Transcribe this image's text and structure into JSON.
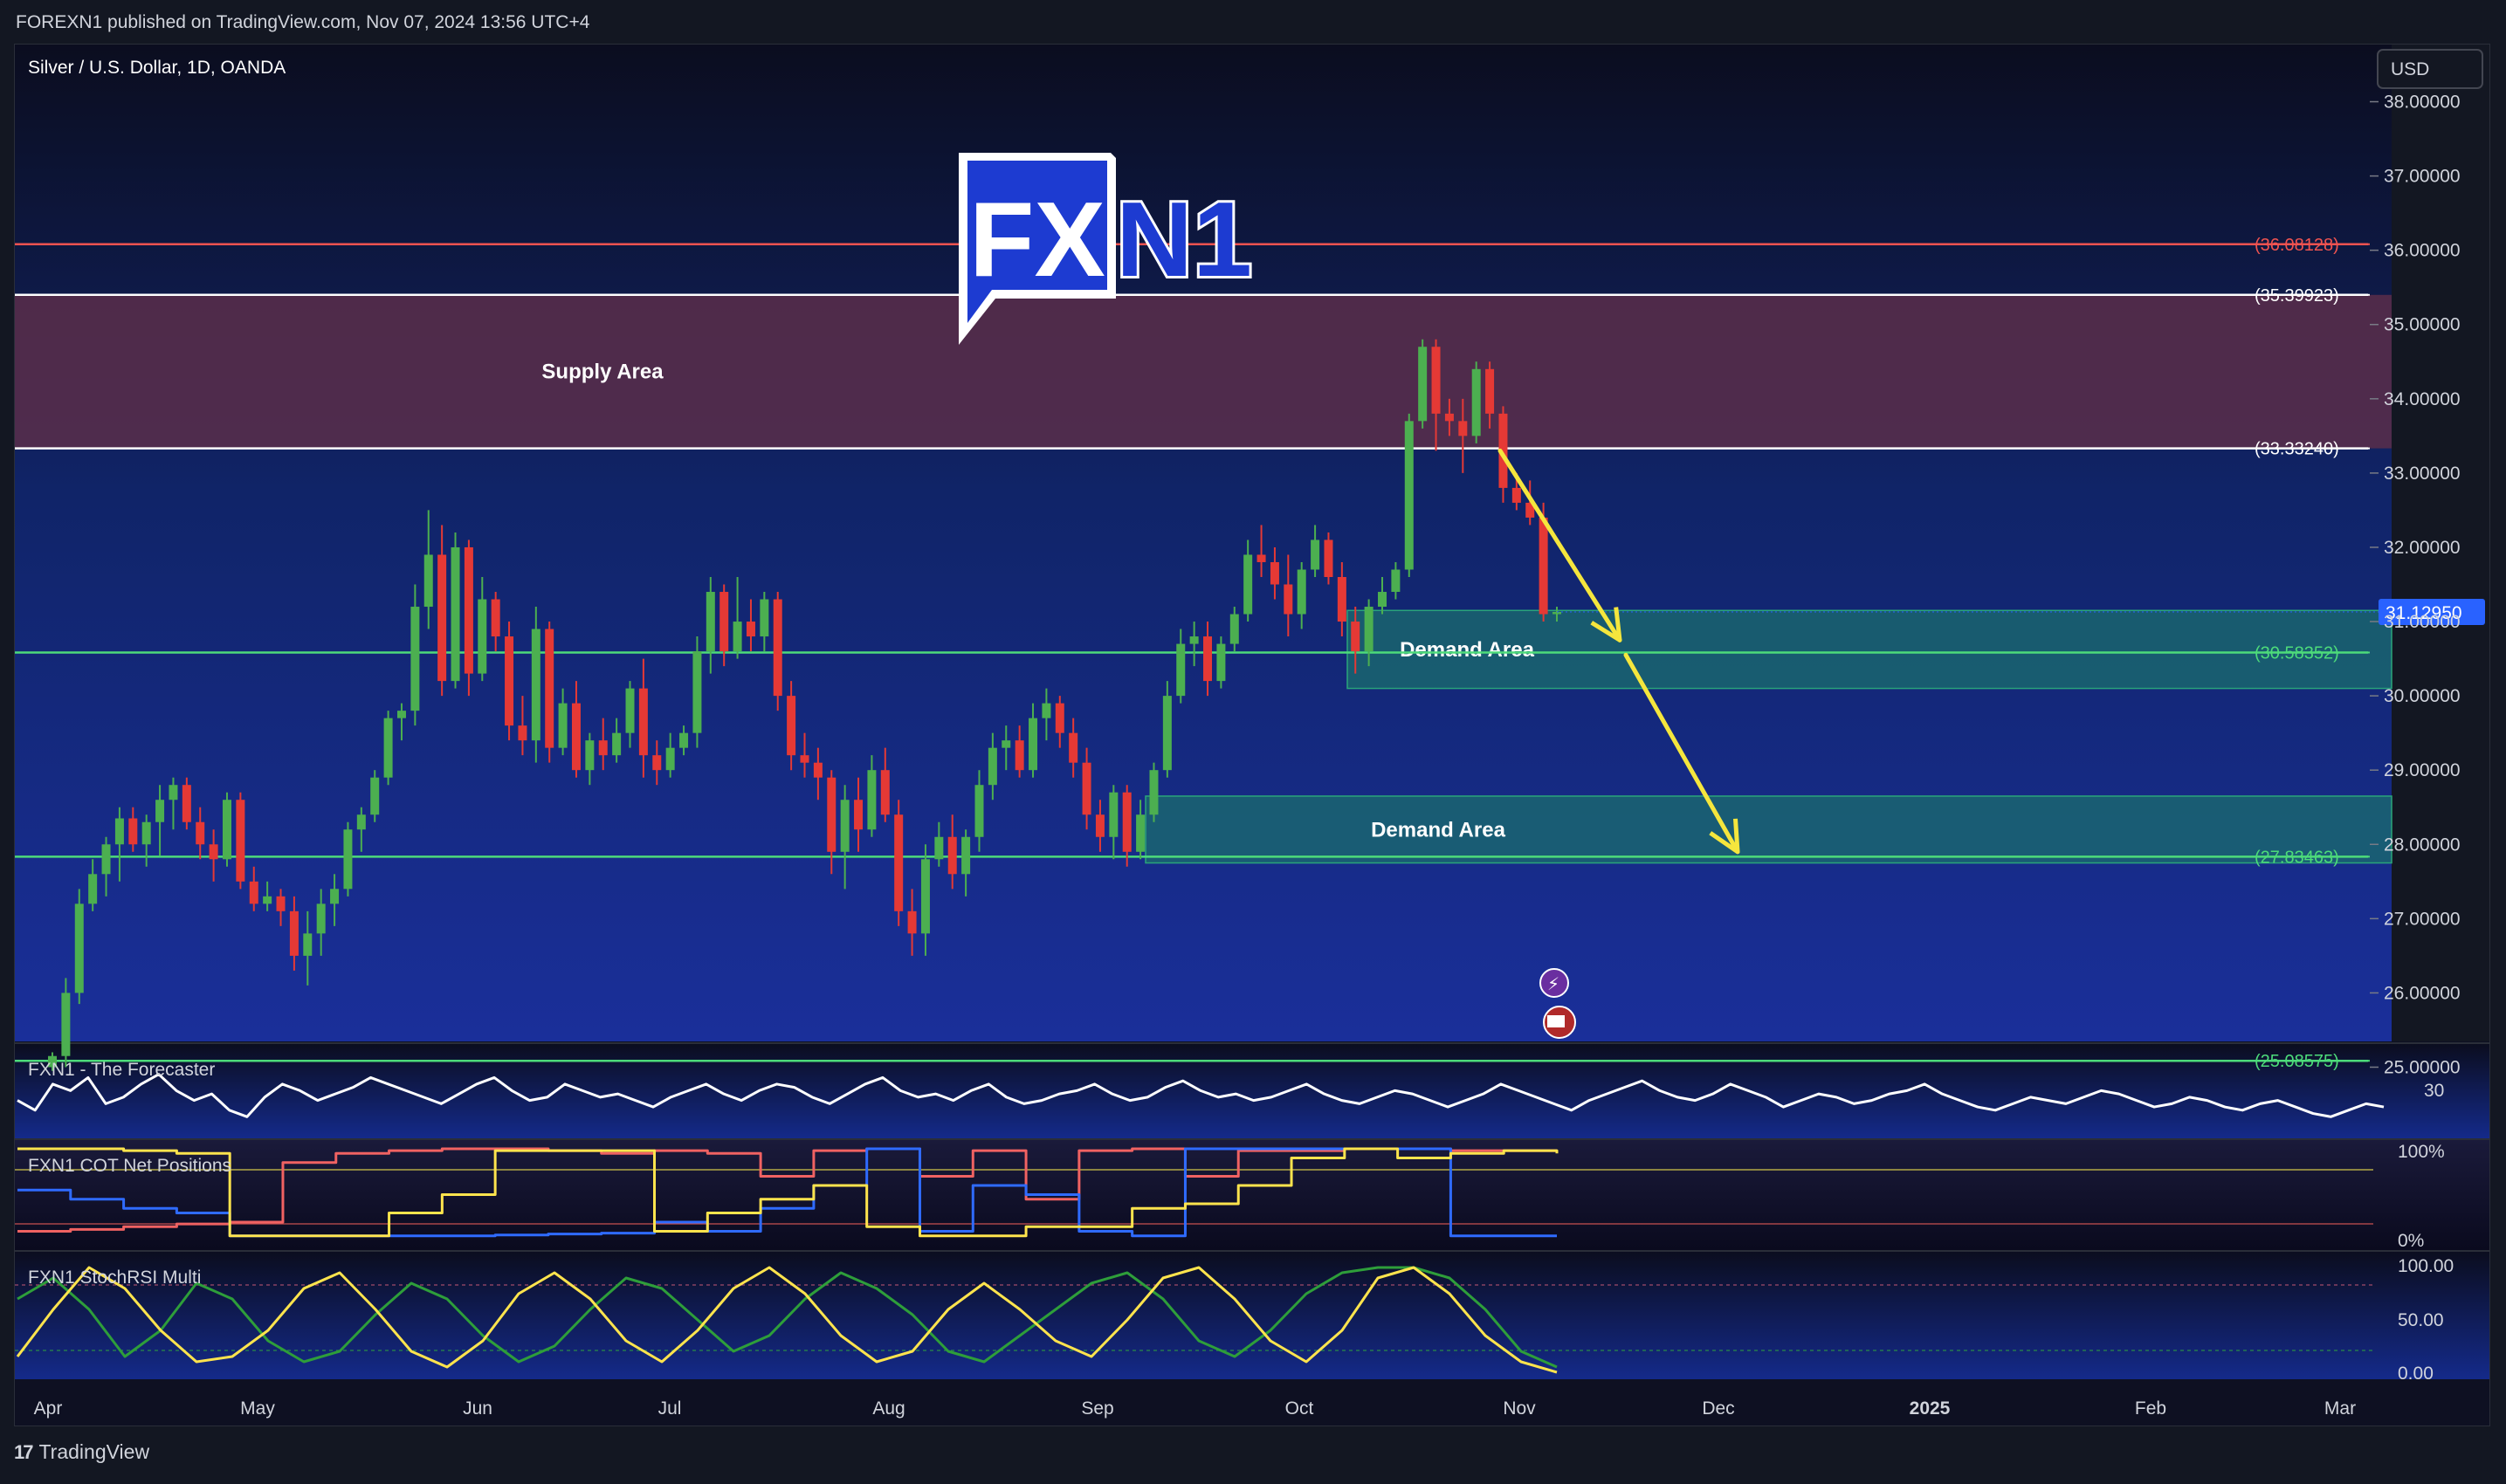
{
  "header": {
    "published_text": "FOREXN1 published on TradingView.com, Nov 07, 2024 13:56 UTC+4"
  },
  "chart": {
    "symbol_title": "Silver / U.S. Dollar, 1D, OANDA",
    "currency_button": "USD",
    "logo_text": {
      "fx": "FX",
      "n1": "N1"
    }
  },
  "footer": {
    "brand": "TradingView",
    "logo_glyph": "17"
  },
  "colors": {
    "background_top": "#0b0d1f",
    "background_bottom": "#1a2f9a",
    "bull": "#4caf50",
    "bear": "#e53935",
    "supply_zone": "#5a2e4a",
    "demand_zone": "#1b6e6e",
    "resistance_red": "#ef5350",
    "level_white": "#ffffff",
    "level_green": "#4ddb7a",
    "arrow_yellow": "#f5e63d",
    "forecaster_line": "#ffffff",
    "cot_red": "#f06262",
    "cot_blue": "#2f6bff",
    "cot_yellow": "#ffe44d",
    "stoch_green": "#2e9e3a",
    "stoch_yellow": "#ffe44d"
  },
  "chart_data": {
    "type": "candlestick",
    "title": "Silver / U.S. Dollar, 1D, OANDA",
    "y_axis_ticks": [
      "38.00000",
      "37.00000",
      "36.00000",
      "35.00000",
      "34.00000",
      "33.00000",
      "32.00000",
      "31.00000",
      "30.00000",
      "29.00000",
      "28.00000",
      "27.00000",
      "26.00000",
      "25.00000"
    ],
    "x_axis_ticks": [
      {
        "label": "Apr",
        "bold": false
      },
      {
        "label": "May",
        "bold": false
      },
      {
        "label": "Jun",
        "bold": false
      },
      {
        "label": "Jul",
        "bold": false
      },
      {
        "label": "Aug",
        "bold": false
      },
      {
        "label": "Sep",
        "bold": false
      },
      {
        "label": "Oct",
        "bold": false
      },
      {
        "label": "Nov",
        "bold": false
      },
      {
        "label": "Dec",
        "bold": false
      },
      {
        "label": "2025",
        "bold": true
      },
      {
        "label": "Feb",
        "bold": false
      },
      {
        "label": "Mar",
        "bold": false
      }
    ],
    "ylim": [
      24.9,
      38.3
    ],
    "current_price": "31.12950",
    "levels": [
      {
        "value": 36.08128,
        "label": "(36.08128)",
        "color": "#ef5350"
      },
      {
        "value": 35.39923,
        "label": "(35.39923)",
        "color": "#ffffff"
      },
      {
        "value": 33.3324,
        "label": "(33.33240)",
        "color": "#ffffff"
      },
      {
        "value": 30.58352,
        "label": "(30.58352)",
        "color": "#4ddb7a"
      },
      {
        "value": 27.83463,
        "label": "(27.83463)",
        "color": "#4ddb7a"
      },
      {
        "value": 25.08575,
        "label": "(25.08575)",
        "color": "#4ddb7a"
      }
    ],
    "zones": [
      {
        "label": "Supply Area",
        "top": 35.39923,
        "bottom": 33.3324,
        "start": "Mar 28, 2024",
        "end": "right edge"
      },
      {
        "label": "Demand Area",
        "top": 31.15,
        "bottom": 30.1,
        "start": "Oct 09, 2024",
        "end": "right edge"
      },
      {
        "label": "Demand Area",
        "top": 28.65,
        "bottom": 27.75,
        "start": "Sep 06, 2024",
        "end": "right edge"
      }
    ],
    "projection_arrows": [
      {
        "from": [
          "Oct 25, 2024",
          33.3
        ],
        "to": [
          "Nov 16, 2024",
          30.7
        ]
      },
      {
        "from": [
          "Nov 16, 2024",
          30.5
        ],
        "to": [
          "Dec 06, 2024",
          27.9
        ]
      }
    ],
    "candles_ohlc": [
      [
        25.0,
        24.95,
        25.2,
        25.15
      ],
      [
        25.15,
        25.0,
        26.2,
        26.0
      ],
      [
        26.0,
        25.85,
        27.4,
        27.2
      ],
      [
        27.2,
        27.1,
        27.8,
        27.6
      ],
      [
        27.6,
        27.3,
        28.1,
        28.0
      ],
      [
        28.0,
        27.5,
        28.5,
        28.35
      ],
      [
        28.35,
        27.9,
        28.5,
        28.0
      ],
      [
        28.0,
        27.7,
        28.4,
        28.3
      ],
      [
        28.3,
        27.85,
        28.8,
        28.6
      ],
      [
        28.6,
        28.2,
        28.9,
        28.8
      ],
      [
        28.8,
        28.2,
        28.9,
        28.3
      ],
      [
        28.3,
        27.8,
        28.5,
        28.0
      ],
      [
        28.0,
        27.5,
        28.2,
        27.8
      ],
      [
        27.8,
        27.7,
        28.7,
        28.6
      ],
      [
        28.6,
        27.4,
        28.7,
        27.5
      ],
      [
        27.5,
        27.1,
        27.7,
        27.2
      ],
      [
        27.2,
        27.1,
        27.5,
        27.3
      ],
      [
        27.3,
        26.9,
        27.4,
        27.1
      ],
      [
        27.1,
        26.3,
        27.3,
        26.5
      ],
      [
        26.5,
        26.1,
        27.1,
        26.8
      ],
      [
        26.8,
        26.5,
        27.4,
        27.2
      ],
      [
        27.2,
        26.9,
        27.6,
        27.4
      ],
      [
        27.4,
        27.3,
        28.3,
        28.2
      ],
      [
        28.2,
        27.9,
        28.5,
        28.4
      ],
      [
        28.4,
        28.3,
        29.0,
        28.9
      ],
      [
        28.9,
        28.8,
        29.8,
        29.7
      ],
      [
        29.7,
        29.4,
        29.9,
        29.8
      ],
      [
        29.8,
        29.6,
        31.5,
        31.2
      ],
      [
        31.2,
        30.9,
        32.5,
        31.9
      ],
      [
        31.9,
        30.0,
        32.3,
        30.2
      ],
      [
        30.2,
        30.1,
        32.2,
        32.0
      ],
      [
        32.0,
        30.0,
        32.1,
        30.3
      ],
      [
        30.3,
        30.2,
        31.6,
        31.3
      ],
      [
        31.3,
        30.6,
        31.4,
        30.8
      ],
      [
        30.8,
        29.4,
        31.0,
        29.6
      ],
      [
        29.6,
        29.2,
        30.0,
        29.4
      ],
      [
        29.4,
        29.1,
        31.2,
        30.9
      ],
      [
        30.9,
        29.1,
        31.0,
        29.3
      ],
      [
        29.3,
        29.2,
        30.1,
        29.9
      ],
      [
        29.9,
        28.9,
        30.2,
        29.0
      ],
      [
        29.0,
        28.8,
        29.5,
        29.4
      ],
      [
        29.4,
        29.0,
        29.7,
        29.2
      ],
      [
        29.2,
        29.1,
        29.7,
        29.5
      ],
      [
        29.5,
        29.3,
        30.2,
        30.1
      ],
      [
        30.1,
        28.9,
        30.5,
        29.2
      ],
      [
        29.2,
        28.8,
        29.4,
        29.0
      ],
      [
        29.0,
        28.9,
        29.5,
        29.3
      ],
      [
        29.3,
        29.2,
        29.6,
        29.5
      ],
      [
        29.5,
        29.3,
        30.8,
        30.6
      ],
      [
        30.6,
        30.3,
        31.6,
        31.4
      ],
      [
        31.4,
        30.4,
        31.5,
        30.6
      ],
      [
        30.6,
        30.5,
        31.6,
        31.0
      ],
      [
        31.0,
        30.6,
        31.3,
        30.8
      ],
      [
        30.8,
        30.6,
        31.4,
        31.3
      ],
      [
        31.3,
        29.8,
        31.4,
        30.0
      ],
      [
        30.0,
        29.0,
        30.2,
        29.2
      ],
      [
        29.2,
        28.9,
        29.5,
        29.1
      ],
      [
        29.1,
        28.6,
        29.3,
        28.9
      ],
      [
        28.9,
        27.6,
        29.0,
        27.9
      ],
      [
        27.9,
        27.4,
        28.8,
        28.6
      ],
      [
        28.6,
        27.9,
        28.9,
        28.2
      ],
      [
        28.2,
        28.1,
        29.2,
        29.0
      ],
      [
        29.0,
        28.3,
        29.3,
        28.4
      ],
      [
        28.4,
        26.9,
        28.6,
        27.1
      ],
      [
        27.1,
        26.5,
        27.4,
        26.8
      ],
      [
        26.8,
        26.5,
        28.0,
        27.8
      ],
      [
        27.8,
        27.7,
        28.3,
        28.1
      ],
      [
        28.1,
        27.4,
        28.4,
        27.6
      ],
      [
        27.6,
        27.3,
        28.2,
        28.1
      ],
      [
        28.1,
        27.9,
        29.0,
        28.8
      ],
      [
        28.8,
        28.6,
        29.5,
        29.3
      ],
      [
        29.3,
        29.0,
        29.6,
        29.4
      ],
      [
        29.4,
        28.9,
        29.6,
        29.0
      ],
      [
        29.0,
        28.9,
        29.9,
        29.7
      ],
      [
        29.7,
        29.4,
        30.1,
        29.9
      ],
      [
        29.9,
        29.3,
        30.0,
        29.5
      ],
      [
        29.5,
        28.9,
        29.7,
        29.1
      ],
      [
        29.1,
        28.2,
        29.3,
        28.4
      ],
      [
        28.4,
        27.9,
        28.6,
        28.1
      ],
      [
        28.1,
        27.8,
        28.8,
        28.7
      ],
      [
        28.7,
        27.7,
        28.8,
        27.9
      ],
      [
        27.9,
        27.8,
        28.6,
        28.4
      ],
      [
        28.4,
        28.3,
        29.1,
        29.0
      ],
      [
        29.0,
        28.9,
        30.2,
        30.0
      ],
      [
        30.0,
        29.9,
        30.9,
        30.7
      ],
      [
        30.7,
        30.4,
        31.0,
        30.8
      ],
      [
        30.8,
        30.0,
        31.0,
        30.2
      ],
      [
        30.2,
        30.1,
        30.8,
        30.7
      ],
      [
        30.7,
        30.6,
        31.2,
        31.1
      ],
      [
        31.1,
        31.0,
        32.1,
        31.9
      ],
      [
        31.9,
        31.6,
        32.3,
        31.8
      ],
      [
        31.8,
        31.3,
        32.0,
        31.5
      ],
      [
        31.5,
        30.8,
        31.9,
        31.1
      ],
      [
        31.1,
        30.9,
        31.8,
        31.7
      ],
      [
        31.7,
        31.6,
        32.3,
        32.1
      ],
      [
        32.1,
        31.5,
        32.2,
        31.6
      ],
      [
        31.6,
        30.8,
        31.8,
        31.0
      ],
      [
        31.0,
        30.3,
        31.2,
        30.6
      ],
      [
        30.6,
        30.4,
        31.3,
        31.2
      ],
      [
        31.2,
        31.1,
        31.6,
        31.4
      ],
      [
        31.4,
        31.3,
        31.8,
        31.7
      ],
      [
        31.7,
        31.6,
        33.8,
        33.7
      ],
      [
        33.7,
        33.6,
        34.8,
        34.7
      ],
      [
        34.7,
        33.3,
        34.8,
        33.8
      ],
      [
        33.8,
        33.5,
        34.0,
        33.7
      ],
      [
        33.7,
        33.0,
        34.0,
        33.5
      ],
      [
        33.5,
        33.4,
        34.5,
        34.4
      ],
      [
        34.4,
        33.6,
        34.5,
        33.8
      ],
      [
        33.8,
        32.6,
        33.9,
        32.8
      ],
      [
        32.8,
        32.5,
        33.0,
        32.6
      ],
      [
        32.6,
        32.3,
        32.9,
        32.4
      ],
      [
        32.4,
        31.0,
        32.6,
        31.1
      ],
      [
        31.1,
        31.0,
        31.2,
        31.13
      ]
    ]
  },
  "indicators": [
    {
      "name": "FXN1 - The Forecaster",
      "axis_labels": [
        "30"
      ],
      "series": [
        {
          "name": "",
          "color": "#ffffff",
          "values": [
            55,
            52,
            60,
            58,
            62,
            54,
            56,
            60,
            63,
            58,
            55,
            57,
            52,
            50,
            56,
            60,
            58,
            55,
            57,
            59,
            62,
            60,
            58,
            56,
            54,
            57,
            60,
            62,
            58,
            55,
            56,
            60,
            58,
            56,
            57,
            55,
            53,
            56,
            58,
            60,
            57,
            55,
            58,
            60,
            59,
            56,
            54,
            57,
            60,
            62,
            58,
            56,
            57,
            55,
            58,
            60,
            56,
            54,
            55,
            57,
            58,
            60,
            57,
            55,
            56,
            59,
            61,
            58,
            56,
            57,
            55,
            56,
            58,
            60,
            57,
            55,
            54,
            56,
            58,
            57,
            55,
            53,
            55,
            57,
            60,
            58,
            56,
            54,
            52,
            55,
            57,
            59,
            61,
            58,
            56,
            55,
            57,
            60,
            58,
            56,
            53,
            55,
            57,
            56,
            54,
            55,
            57,
            58,
            60,
            57,
            55,
            53,
            52,
            54,
            56,
            55,
            54,
            56,
            58,
            57,
            55,
            53,
            54,
            56,
            55,
            53,
            52,
            54,
            55,
            53,
            51,
            50,
            52,
            54,
            53
          ]
        }
      ]
    },
    {
      "name": "FXN1 COT Net Positions",
      "axis_labels": [
        "100%",
        "0%"
      ],
      "series": [
        {
          "name": "",
          "color": "#f06262",
          "values": [
            0.1,
            0.12,
            0.15,
            0.18,
            0.2,
            0.85,
            0.95,
            0.98,
            1.0,
            1.0,
            0.98,
            0.95,
            0.98,
            0.95,
            0.7,
            0.98,
            1.0,
            0.7,
            0.98,
            0.45,
            0.98,
            1.0,
            0.7,
            0.98,
            0.98,
            1.0,
            1.0,
            0.98,
            0.98,
            0.98
          ]
        },
        {
          "name": "",
          "color": "#2f6bff",
          "values": [
            0.55,
            0.45,
            0.35,
            0.3,
            0.05,
            0.05,
            0.05,
            0.05,
            0.05,
            0.06,
            0.07,
            0.08,
            0.2,
            0.1,
            0.35,
            0.6,
            1.0,
            0.1,
            0.6,
            0.5,
            0.1,
            0.05,
            1.0,
            1.0,
            1.0,
            1.0,
            1.0,
            0.05,
            0.05,
            0.05
          ]
        },
        {
          "name": "",
          "color": "#ffe44d",
          "values": [
            1.0,
            1.0,
            0.98,
            0.95,
            0.05,
            0.05,
            0.05,
            0.3,
            0.5,
            0.98,
            0.98,
            0.98,
            0.1,
            0.3,
            0.45,
            0.6,
            0.15,
            0.05,
            0.05,
            0.15,
            0.15,
            0.35,
            0.4,
            0.6,
            0.9,
            1.0,
            0.9,
            0.95,
            0.98,
            0.95
          ]
        }
      ]
    },
    {
      "name": "FXN1 StochRSI Multi",
      "axis_labels": [
        "100.00",
        "50.00",
        "0.00"
      ],
      "series": [
        {
          "name": "",
          "color": "#2e9e3a",
          "values": [
            70,
            90,
            60,
            15,
            40,
            85,
            70,
            30,
            10,
            20,
            55,
            85,
            70,
            35,
            10,
            25,
            60,
            90,
            80,
            50,
            20,
            35,
            70,
            95,
            80,
            55,
            20,
            10,
            35,
            60,
            85,
            95,
            70,
            30,
            15,
            40,
            75,
            95,
            100,
            100,
            90,
            60,
            20,
            5
          ]
        },
        {
          "name": "",
          "color": "#ffe44d",
          "values": [
            15,
            60,
            100,
            80,
            40,
            10,
            15,
            40,
            80,
            95,
            60,
            20,
            5,
            30,
            75,
            95,
            70,
            30,
            10,
            40,
            80,
            100,
            75,
            35,
            10,
            20,
            60,
            85,
            60,
            30,
            15,
            50,
            90,
            100,
            70,
            30,
            10,
            40,
            90,
            100,
            75,
            35,
            10,
            0
          ]
        }
      ]
    }
  ]
}
